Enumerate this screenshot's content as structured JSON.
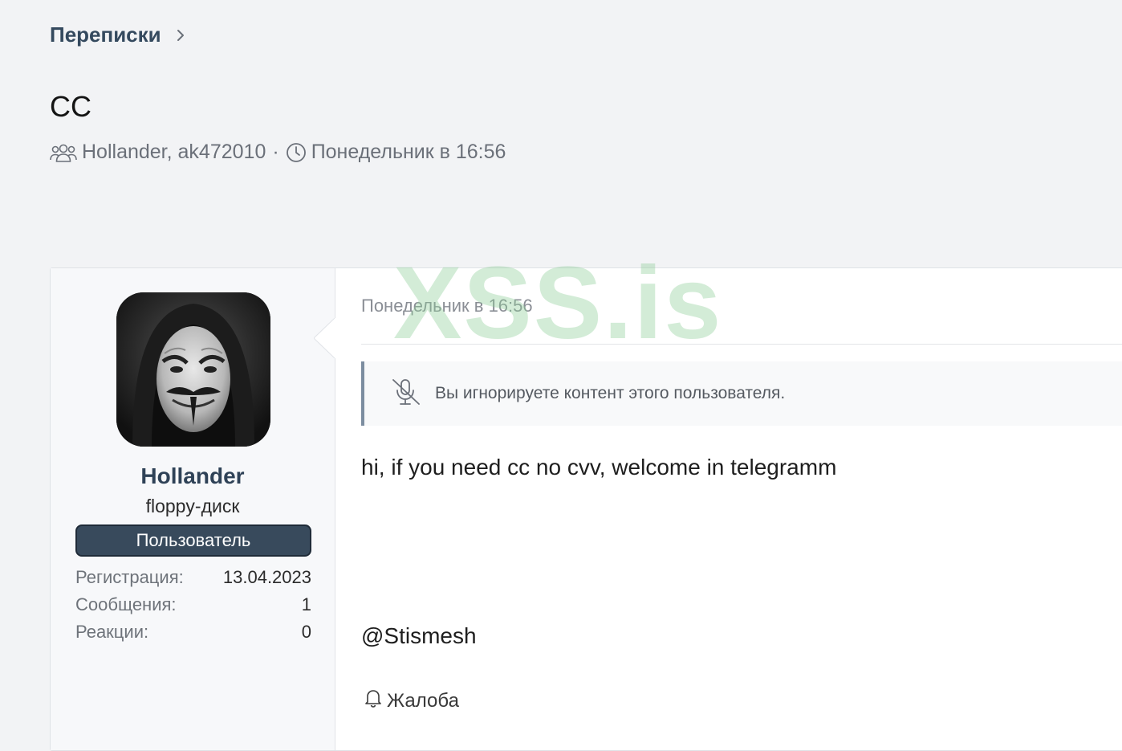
{
  "breadcrumb": {
    "label": "Переписки"
  },
  "conversation": {
    "title": "CC",
    "participants": "Hollander, ak472010",
    "separator": "·",
    "last_activity": "Понедельник в 16:56"
  },
  "user": {
    "name": "Hollander",
    "title": "floppy-диск",
    "role_badge": "Пользователь",
    "stats": [
      {
        "label": "Регистрация:",
        "value": "13.04.2023"
      },
      {
        "label": "Сообщения:",
        "value": "1"
      },
      {
        "label": "Реакции:",
        "value": "0"
      }
    ]
  },
  "message": {
    "date": "Понедельник в 16:56",
    "ignore_notice": "Вы игнорируете контент этого пользователя.",
    "body": "hi, if you need cc no cvv, welcome in telegramm",
    "handle": "@Stismesh",
    "report_label": "Жалоба"
  },
  "watermark": "XSS.is",
  "icons": {
    "breadcrumb_chevron": "chevron-right-icon",
    "participants": "users-icon",
    "time": "clock-icon",
    "ignore": "microphone-slash-icon",
    "report": "bell-icon"
  },
  "colors": {
    "background": "#f2f3f5",
    "link": "#34495e",
    "badge": "#384a5c",
    "notice_border": "#7c8da0",
    "watermark": "#8ccd96"
  }
}
